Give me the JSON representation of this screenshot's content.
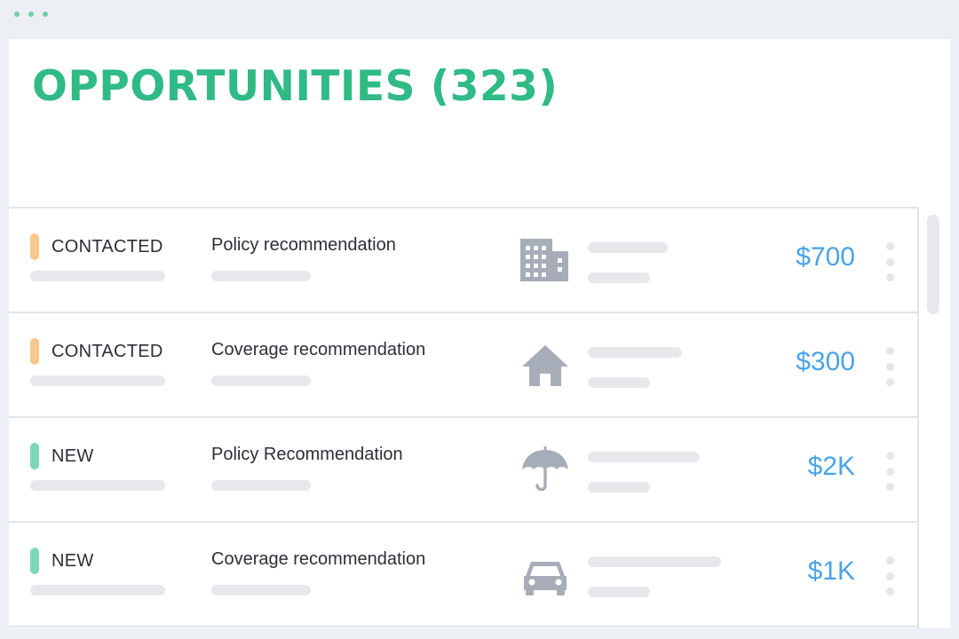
{
  "header": {
    "title": "OPPORTUNITIES (323)"
  },
  "colors": {
    "accent": "#2fba86",
    "contacted": "#f8c78c",
    "new": "#7dd8b5",
    "amount": "#4aa3e8",
    "icon": "#a7adb8"
  },
  "rows": [
    {
      "status": "CONTACTED",
      "description": "Policy recommendation",
      "icon": "building-icon",
      "amount": "$700"
    },
    {
      "status": "CONTACTED",
      "description": "Coverage recommendation",
      "icon": "house-icon",
      "amount": "$300"
    },
    {
      "status": "NEW",
      "description": "Policy Recommendation",
      "icon": "umbrella-icon",
      "amount": "$2K"
    },
    {
      "status": "NEW",
      "description": "Coverage recommendation",
      "icon": "car-icon",
      "amount": "$1K"
    }
  ]
}
